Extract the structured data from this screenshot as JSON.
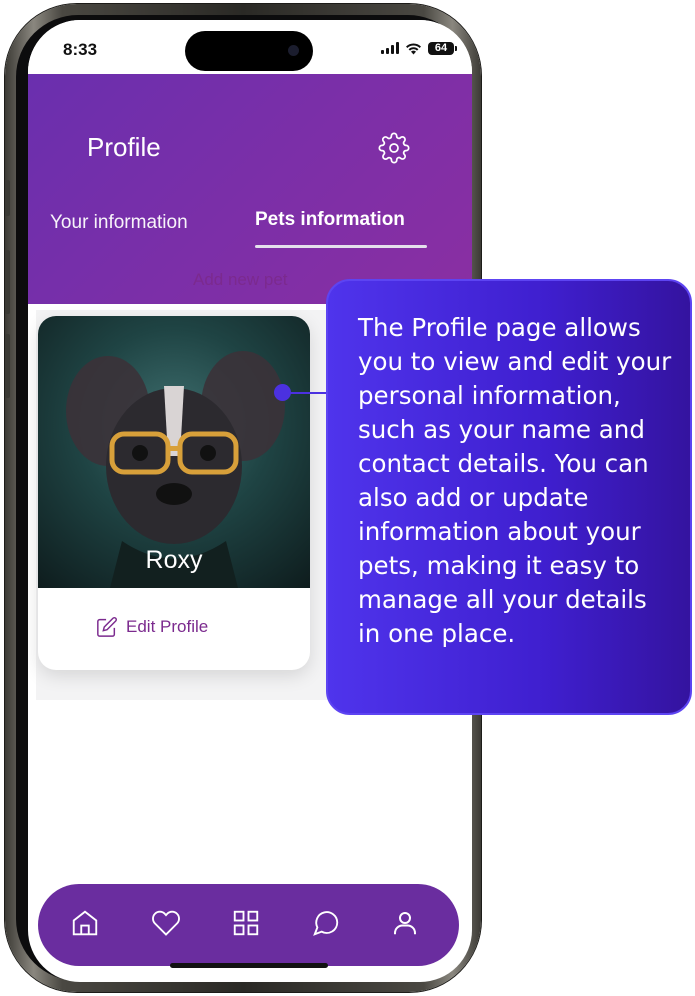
{
  "status_bar": {
    "time": "8:33",
    "battery": "64"
  },
  "header": {
    "title": "Profile",
    "tabs": [
      {
        "label": "Your information"
      },
      {
        "label": "Pets information"
      }
    ]
  },
  "content": {
    "add_pet_label": "Add new pet",
    "pet": {
      "name": "Roxy",
      "edit_label": "Edit Profile"
    }
  },
  "bottom_nav": {
    "items": [
      "home-icon",
      "heart-icon",
      "grid-icon",
      "chat-icon",
      "user-icon"
    ]
  },
  "callout": {
    "text": "The Profile page allows you to view and edit your personal information, such as your name and contact details. You can also add or update information about your pets, making it easy to manage all your details in one place."
  },
  "colors": {
    "header_accent": "#7b2fa8",
    "nav_bg": "#6a2d9f",
    "callout_bg": "#4f34ec",
    "link_color": "#7b2a8e"
  }
}
